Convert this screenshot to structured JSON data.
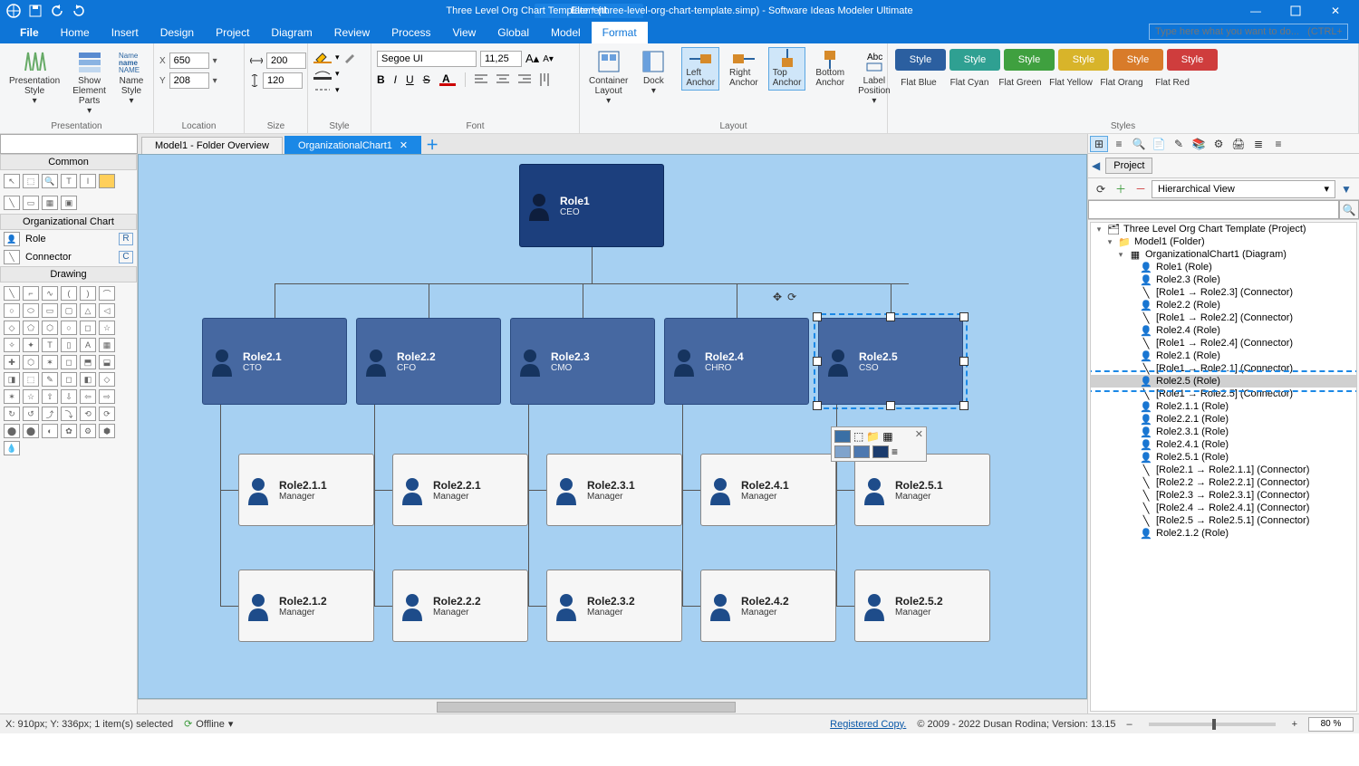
{
  "title": {
    "context_tab": "Element",
    "doc": "Three Level Org Chart Template * (three-level-org-chart-template.simp)  - Software Ideas Modeler Ultimate"
  },
  "menu": [
    "File",
    "Home",
    "Insert",
    "Design",
    "Project",
    "Diagram",
    "Review",
    "Process",
    "View",
    "Global",
    "Model",
    "Format"
  ],
  "menu_active": "Format",
  "search_placeholder": "Type here what you want to do...   (CTRL+Q)",
  "ribbon": {
    "presentation": {
      "label": "Presentation",
      "btn1": "Presentation Style",
      "btn2": "Show Element Parts",
      "btn3": "Name Style"
    },
    "location": {
      "label": "Location",
      "x_label": "X",
      "x": "650",
      "y_label": "Y",
      "y": "208"
    },
    "size": {
      "label": "Size",
      "w": "200",
      "h": "120"
    },
    "style": {
      "label": "Style"
    },
    "font": {
      "label": "Font",
      "family": "Segoe UI",
      "size": "11,25"
    },
    "layout": {
      "label": "Layout",
      "container": "Container Layout",
      "dock": "Dock",
      "anchors": [
        "Left Anchor",
        "Right Anchor",
        "Top Anchor",
        "Bottom Anchor"
      ],
      "active_anchors": [
        0,
        2
      ],
      "label_pos": "Label Position"
    },
    "styles": {
      "label": "Styles",
      "items": [
        {
          "label": "Style",
          "name": "Flat Blue",
          "bg": "#2b5fa0"
        },
        {
          "label": "Style",
          "name": "Flat Cyan",
          "bg": "#2fa092"
        },
        {
          "label": "Style",
          "name": "Flat Green",
          "bg": "#3fa03f"
        },
        {
          "label": "Style",
          "name": "Flat Yellow",
          "bg": "#d8b42a"
        },
        {
          "label": "Style",
          "name": "Flat Orang",
          "bg": "#d87b2a"
        },
        {
          "label": "Style",
          "name": "Flat Red",
          "bg": "#cf3d3d"
        }
      ]
    }
  },
  "toolbox": {
    "headers": {
      "common": "Common",
      "org": "Organizational Chart",
      "drawing": "Drawing"
    },
    "items": {
      "role": "Role",
      "role_kbd": "R",
      "connector": "Connector",
      "connector_kbd": "C"
    }
  },
  "tabs": {
    "left": "Model1 - Folder Overview",
    "right": "OrganizationalChart1"
  },
  "diagram": {
    "root": {
      "name": "Role1",
      "sub": "CEO"
    },
    "level2": [
      {
        "name": "Role2.1",
        "sub": "CTO"
      },
      {
        "name": "Role2.2",
        "sub": "CFO"
      },
      {
        "name": "Role2.3",
        "sub": "CMO"
      },
      {
        "name": "Role2.4",
        "sub": "CHRO"
      },
      {
        "name": "Role2.5",
        "sub": "CSO"
      }
    ],
    "level3a": [
      {
        "name": "Role2.1.1",
        "sub": "Manager"
      },
      {
        "name": "Role2.2.1",
        "sub": "Manager"
      },
      {
        "name": "Role2.3.1",
        "sub": "Manager"
      },
      {
        "name": "Role2.4.1",
        "sub": "Manager"
      },
      {
        "name": "Role2.5.1",
        "sub": "Manager"
      }
    ],
    "level3b": [
      {
        "name": "Role2.1.2",
        "sub": "Manager"
      },
      {
        "name": "Role2.2.2",
        "sub": "Manager"
      },
      {
        "name": "Role2.3.2",
        "sub": "Manager"
      },
      {
        "name": "Role2.4.2",
        "sub": "Manager"
      },
      {
        "name": "Role2.5.2",
        "sub": "Manager"
      }
    ]
  },
  "project_panel": {
    "title": "Project",
    "view": "Hierarchical View",
    "tree": [
      {
        "t": "Three Level Org Chart Template (Project)",
        "lvl": 0,
        "toggle": "▾",
        "icon": "proj"
      },
      {
        "t": "Model1 (Folder)",
        "lvl": 1,
        "toggle": "▾",
        "icon": "folder"
      },
      {
        "t": "OrganizationalChart1 (Diagram)",
        "lvl": 2,
        "toggle": "▾",
        "icon": "diagram"
      },
      {
        "t": "Role1 (Role)",
        "lvl": 3,
        "icon": "role"
      },
      {
        "t": "Role2.3 (Role)",
        "lvl": 3,
        "icon": "role"
      },
      {
        "t": "[Role1 → Role2.3] (Connector)",
        "lvl": 3,
        "icon": "conn"
      },
      {
        "t": "Role2.2 (Role)",
        "lvl": 3,
        "icon": "role"
      },
      {
        "t": "[Role1 → Role2.2] (Connector)",
        "lvl": 3,
        "icon": "conn"
      },
      {
        "t": "Role2.4 (Role)",
        "lvl": 3,
        "icon": "role"
      },
      {
        "t": "[Role1 → Role2.4] (Connector)",
        "lvl": 3,
        "icon": "conn"
      },
      {
        "t": "Role2.1 (Role)",
        "lvl": 3,
        "icon": "role"
      },
      {
        "t": "[Role1 → Role2.1] (Connector)",
        "lvl": 3,
        "icon": "conn"
      },
      {
        "t": "Role2.5 (Role)",
        "lvl": 3,
        "icon": "role",
        "sel": true
      },
      {
        "t": "[Role1 → Role2.5] (Connector)",
        "lvl": 3,
        "icon": "conn"
      },
      {
        "t": "Role2.1.1 (Role)",
        "lvl": 3,
        "icon": "role"
      },
      {
        "t": "Role2.2.1 (Role)",
        "lvl": 3,
        "icon": "role"
      },
      {
        "t": "Role2.3.1 (Role)",
        "lvl": 3,
        "icon": "role"
      },
      {
        "t": "Role2.4.1 (Role)",
        "lvl": 3,
        "icon": "role"
      },
      {
        "t": "Role2.5.1 (Role)",
        "lvl": 3,
        "icon": "role"
      },
      {
        "t": "[Role2.1 → Role2.1.1] (Connector)",
        "lvl": 3,
        "icon": "conn"
      },
      {
        "t": "[Role2.2 → Role2.2.1] (Connector)",
        "lvl": 3,
        "icon": "conn"
      },
      {
        "t": "[Role2.3 → Role2.3.1] (Connector)",
        "lvl": 3,
        "icon": "conn"
      },
      {
        "t": "[Role2.4 → Role2.4.1] (Connector)",
        "lvl": 3,
        "icon": "conn"
      },
      {
        "t": "[Role2.5 → Role2.5.1] (Connector)",
        "lvl": 3,
        "icon": "conn"
      },
      {
        "t": "Role2.1.2 (Role)",
        "lvl": 3,
        "icon": "role"
      }
    ]
  },
  "status": {
    "coords": "X: 910px; Y: 336px; 1 item(s) selected",
    "offline": "Offline",
    "registered": "Registered Copy.",
    "copyright": "© 2009 - 2022 Dusan Rodina; Version: 13.15",
    "zoom": "80 %"
  }
}
